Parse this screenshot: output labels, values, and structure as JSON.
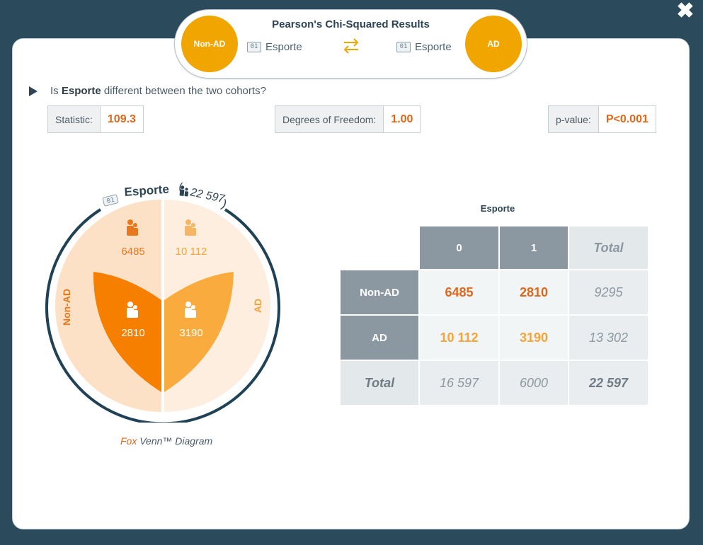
{
  "window": {
    "title": "Pearson's Chi-Squared Results",
    "close_icon": "close-icon"
  },
  "header": {
    "left_cohort": "Non-AD",
    "right_cohort": "AD",
    "left_variable": "Esporte",
    "right_variable": "Esporte",
    "variable_icon": "binary-variable-icon",
    "binary_icon_glyph": "01",
    "swap_icon": "swap-arrows-icon"
  },
  "question": {
    "prefix": "Is ",
    "variable": "Esporte",
    "suffix": " different between the two cohorts?"
  },
  "stats": {
    "statistic_label": "Statistic:",
    "statistic_value": "109.3",
    "df_label": "Degrees of Freedom:",
    "df_value": "1.00",
    "p_label": "p-value:",
    "p_value": "P<0.001"
  },
  "venn": {
    "variable": "Esporte",
    "total": "22 597",
    "left_label": "Non-AD",
    "right_label": "AD",
    "values": {
      "nonad_0": "6485",
      "ad_0": "10 112",
      "nonad_1": "2810",
      "ad_1": "3190"
    },
    "caption_fox": "Fox",
    "caption_rest": " Venn™ Diagram",
    "colors": {
      "nonad_outer": "#fde1c7",
      "ad_outer": "#fdeee0",
      "nonad_inner": "#f77f00",
      "ad_inner": "#f9ac3d",
      "ring": "#1f4256"
    }
  },
  "contingency_table": {
    "title": "Esporte",
    "columns": [
      "0",
      "1",
      "Total"
    ],
    "rows": [
      {
        "label": "Non-AD",
        "values": [
          "6485",
          "2810"
        ],
        "total": "9295"
      },
      {
        "label": "AD",
        "values": [
          "10 112",
          "3190"
        ],
        "total": "13 302"
      }
    ],
    "total_row": {
      "label": "Total",
      "values": [
        "16 597",
        "6000"
      ],
      "total": "22 597"
    },
    "colors": {
      "nonad_value": "#e0661a",
      "ad_value": "#f3a43b"
    }
  }
}
